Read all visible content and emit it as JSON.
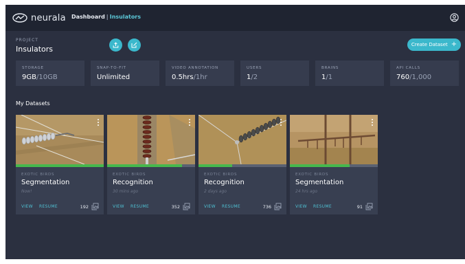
{
  "header": {
    "logo_text": "neurala",
    "breadcrumb": {
      "root": "Dashboard",
      "separator": "|",
      "current": "Insulators"
    },
    "account_icon": "user-circle-icon"
  },
  "project": {
    "label": "PROJECT",
    "name": "Insulators",
    "actions": {
      "upload_icon": "upload-icon",
      "edit_icon": "edit-icon"
    },
    "create_label": "Create Dataset",
    "create_icon": "plus-icon"
  },
  "stats": [
    {
      "label": "STORAGE",
      "value": "9GB",
      "max": "/10GB"
    },
    {
      "label": "SNAP-TO-FIT",
      "value": "Unlimited",
      "max": ""
    },
    {
      "label": "VIDEO ANNOTATION",
      "value": "0.5hrs",
      "max": "/1hr"
    },
    {
      "label": "USERS",
      "value": "1",
      "max": "/2"
    },
    {
      "label": "BRAINS",
      "value": "1",
      "max": "/1"
    },
    {
      "label": "API CALLS",
      "value": "760",
      "max": "/1,000"
    }
  ],
  "datasets_title": "My Datasets",
  "datasets": [
    {
      "category": "EXOTIC BIRDS",
      "title": "Segmentation",
      "time": "Now!",
      "progress": 1.0,
      "view": "VIEW",
      "resume": "RESUME",
      "count": "192"
    },
    {
      "category": "EXOTIC BIRDS",
      "title": "Recognition",
      "time": "30 mins ago",
      "progress": 0.85,
      "view": "VIEW",
      "resume": "RESUME",
      "count": "352"
    },
    {
      "category": "EXOTIC BIRDS",
      "title": "Recognition",
      "time": "2 days ago",
      "progress": 0.38,
      "view": "VIEW",
      "resume": "RESUME",
      "count": "736"
    },
    {
      "category": "EXOTIC BIRDS",
      "title": "Segmentation",
      "time": "24 hrs ago",
      "progress": 0.68,
      "view": "VIEW",
      "resume": "RESUME",
      "count": "91"
    }
  ],
  "colors": {
    "accent": "#3bb8cc",
    "progress": "#46b84d",
    "background": "#2b3040",
    "topbar": "#1f2431",
    "card": "#383f51"
  }
}
